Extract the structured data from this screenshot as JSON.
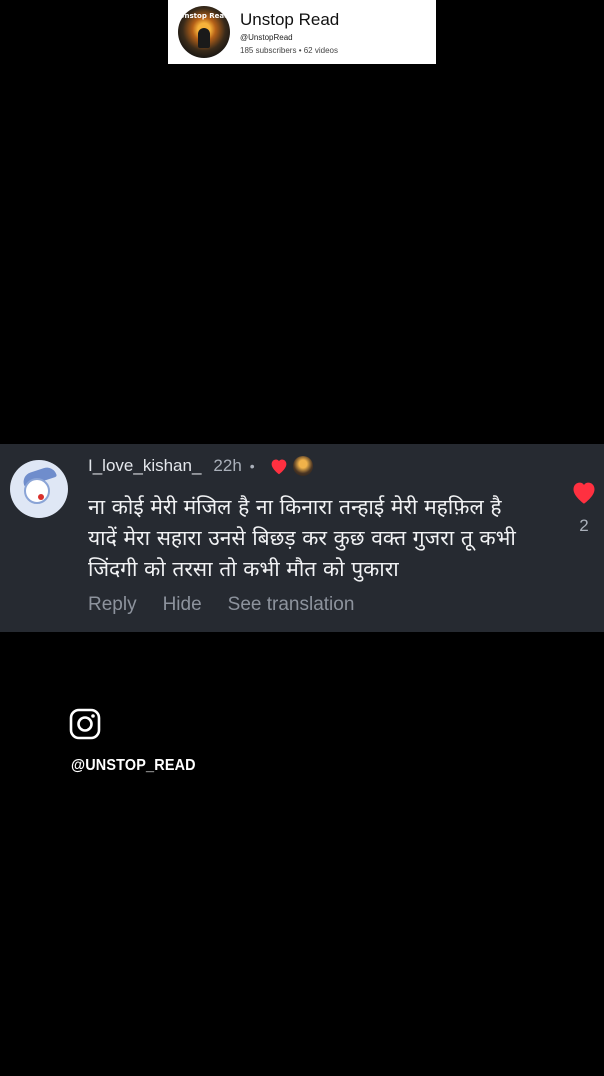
{
  "channel_card": {
    "name": "Unstop Read",
    "handle": "@UnstopRead",
    "stats": "185 subscribers • 62 videos",
    "avatar_text": "Unstop Read"
  },
  "comment": {
    "username": "I_love_kishan_",
    "time": "22h",
    "separator": "•",
    "text_lines": [
      "ना कोई मेरी मंजिल है ना किनारा तन्हाई मेरी महफ़िल है",
      "यादें मेरा सहारा उनसे बिछड़ कर कुछ वक्त गुजरा तू कभी",
      "जिंदगी को तरसा तो कभी मौत को पुकारा"
    ],
    "likes": "2",
    "actions": {
      "reply": "Reply",
      "hide": "Hide",
      "see_translation": "See translation"
    },
    "icons": {
      "creator_heart": "heart-icon",
      "like": "heart-icon"
    },
    "colors": {
      "heart": "#ff3040",
      "panel_bg": "#262a31"
    }
  },
  "watermark": {
    "icon": "instagram-icon",
    "handle": "@UNSTOP_READ"
  }
}
